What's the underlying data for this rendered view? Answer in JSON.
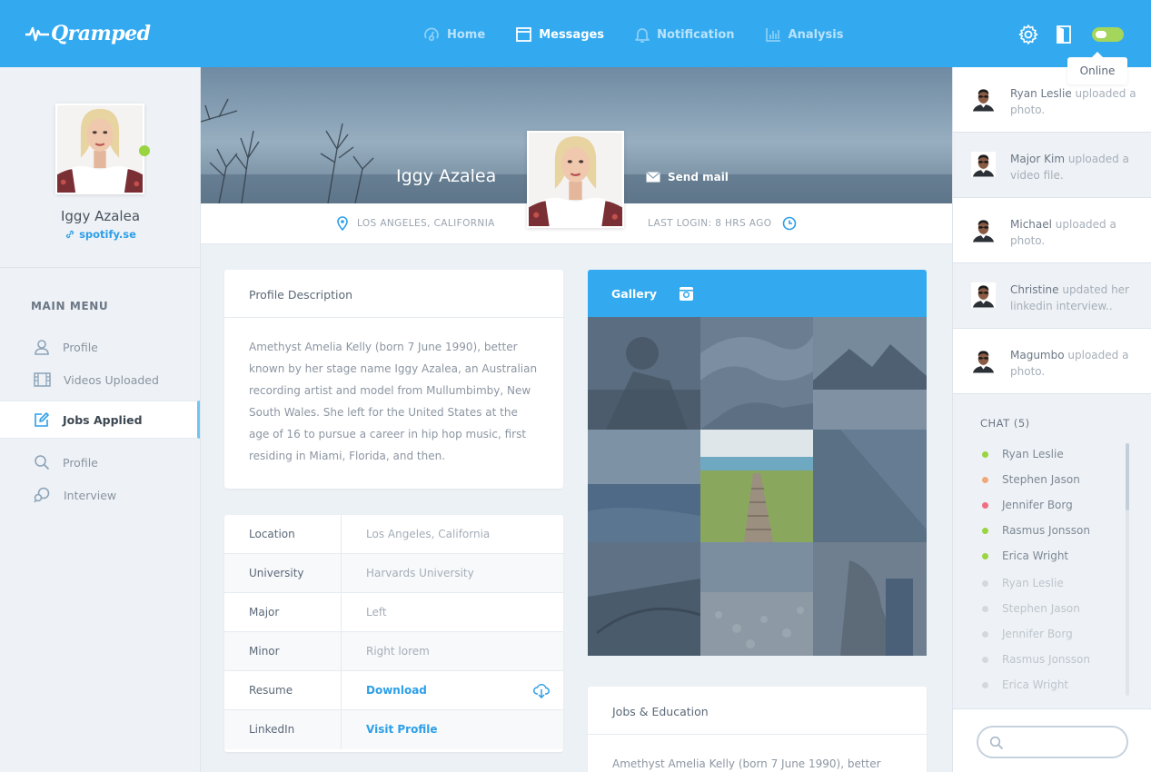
{
  "app": {
    "name": "Qramped"
  },
  "nav": [
    {
      "label": "Home",
      "active": false,
      "icon": "home-icon"
    },
    {
      "label": "Messages",
      "active": true,
      "icon": "messages-icon"
    },
    {
      "label": "Notification",
      "active": false,
      "icon": "bell-icon"
    },
    {
      "label": "Analysis",
      "active": false,
      "icon": "chart-icon"
    }
  ],
  "status": {
    "tooltip": "Online",
    "toggle_on": true
  },
  "sidebar": {
    "name": "Iggy Azalea",
    "link": "spotify.se",
    "menu_title": "MAIN MENU",
    "items": [
      {
        "label": "Profile",
        "icon": "user-icon",
        "active": false
      },
      {
        "label": "Videos Uploaded",
        "icon": "film-icon",
        "active": false
      },
      {
        "label": "Jobs Applied",
        "icon": "edit-icon",
        "active": true
      },
      {
        "label": "Profile",
        "icon": "search-icon",
        "active": false
      },
      {
        "label": "Interview",
        "icon": "chat-icon",
        "active": false
      }
    ]
  },
  "hero": {
    "name": "Iggy Azalea",
    "send_mail": "Send mail",
    "location": "LOS ANGELES, CALIFORNIA",
    "last_login": "LAST LOGIN: 8 HRS AGO"
  },
  "profile": {
    "title": "Profile Description",
    "description": "Amethyst Amelia Kelly (born 7 June 1990), better known by her stage name Iggy Azalea, an Australian recording artist and model from Mullumbimby, New South Wales. She left for the United States at the age of 16 to pursue a career in hip hop music, first residing in Miami, Florida, and then."
  },
  "info": [
    {
      "label": "Location",
      "value": "Los Angeles, California"
    },
    {
      "label": "University",
      "value": "Harvards University"
    },
    {
      "label": "Major",
      "value": "Left"
    },
    {
      "label": "Minor",
      "value": "Right lorem"
    },
    {
      "label": "Resume",
      "value": "Download"
    },
    {
      "label": "LinkedIn",
      "value": "Visit Profile"
    }
  ],
  "gallery": {
    "title": "Gallery"
  },
  "jobs": {
    "title": "Jobs & Education",
    "text": "Amethyst Amelia Kelly (born 7 June 1990), better"
  },
  "activity": [
    {
      "name": "Ryan Leslie",
      "action": "uploaded a photo."
    },
    {
      "name": "Major Kim",
      "action": "uploaded a video file."
    },
    {
      "name": "Michael",
      "action": "uploaded a photo."
    },
    {
      "name": "Christine",
      "action": "updated her linkedin interview.."
    },
    {
      "name": "Magumbo",
      "action": "uploaded a photo."
    }
  ],
  "chat": {
    "title": "CHAT (5)",
    "users": [
      {
        "name": "Ryan Leslie",
        "status_color": "#9bd441",
        "online": true
      },
      {
        "name": "Stephen Jason",
        "status_color": "#f2a878",
        "online": true
      },
      {
        "name": "Jennifer Borg",
        "status_color": "#ee6f82",
        "online": true
      },
      {
        "name": "Rasmus Jonsson",
        "status_color": "#9bd441",
        "online": true
      },
      {
        "name": "Erica Wright",
        "status_color": "#9bd441",
        "online": true
      },
      {
        "name": "Ryan Leslie",
        "status_color": "#d2d8de",
        "online": false
      },
      {
        "name": "Stephen Jason",
        "status_color": "#d2d8de",
        "online": false
      },
      {
        "name": "Jennifer Borg",
        "status_color": "#d2d8de",
        "online": false
      },
      {
        "name": "Rasmus Jonsson",
        "status_color": "#d2d8de",
        "online": false
      },
      {
        "name": "Erica Wright",
        "status_color": "#d2d8de",
        "online": false
      }
    ]
  },
  "colors": {
    "accent": "#33aaf0",
    "online": "#9bd441"
  }
}
